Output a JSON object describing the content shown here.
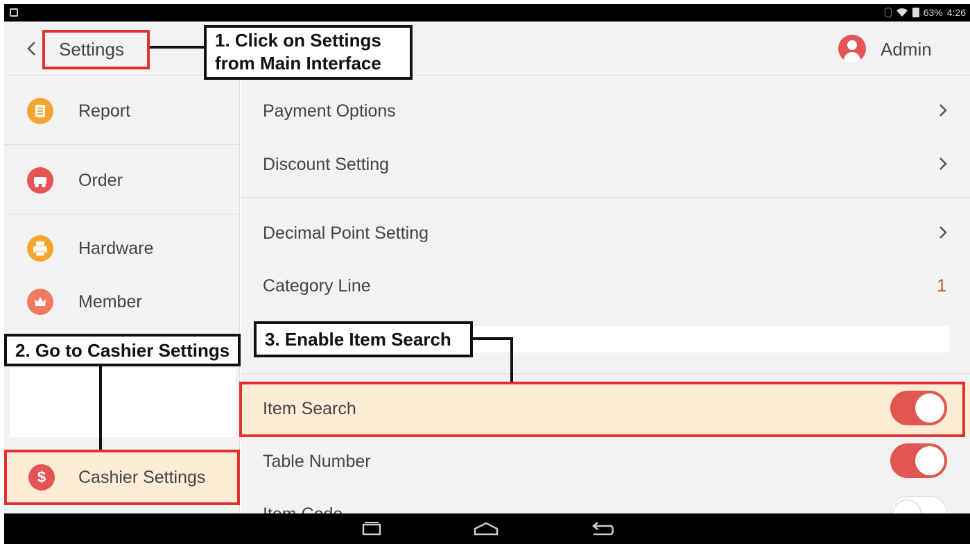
{
  "status_bar": {
    "battery": "63%",
    "time": "4:26"
  },
  "header": {
    "title": "Settings",
    "user": "Admin"
  },
  "sidebar": {
    "items": [
      {
        "label": "Report",
        "icon": "report-icon",
        "color": "#f7a531"
      },
      {
        "label": "Order",
        "icon": "order-icon",
        "color": "#e65353"
      },
      {
        "label": "Hardware",
        "icon": "printer-icon",
        "color": "#f7a531"
      },
      {
        "label": "Member",
        "icon": "member-crown-icon",
        "color": "#f07a60"
      },
      {
        "label": "Cashier Settings",
        "icon": "dollar-icon",
        "color": "#e65353",
        "symbol": "$"
      }
    ]
  },
  "main": {
    "rows": [
      {
        "label": "Payment Options",
        "type": "chevron"
      },
      {
        "label": "Discount Setting",
        "type": "chevron"
      },
      {
        "label": "Decimal Point Setting",
        "type": "chevron"
      },
      {
        "label": "Category Line",
        "type": "value",
        "value": "1"
      },
      {
        "label": "Item Search",
        "type": "toggle",
        "on": true
      },
      {
        "label": "Table Number",
        "type": "toggle",
        "on": true
      },
      {
        "label": "Item Code",
        "type": "toggle",
        "on": false
      }
    ]
  },
  "annotations": {
    "step1_line1": "1. Click on Settings",
    "step1_line2": "from Main Interface",
    "step2": "2. Go to Cashier Settings",
    "step3": "3. Enable Item Search"
  },
  "colors": {
    "accent_red": "#e0574f",
    "highlight": "#fdecd5",
    "annotation_red": "#e03131"
  }
}
